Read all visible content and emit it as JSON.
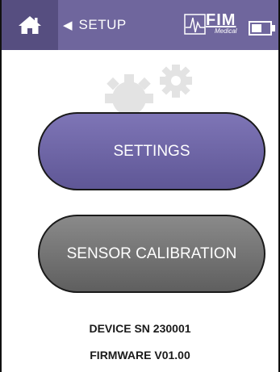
{
  "topbar": {
    "back_label": "SETUP",
    "home_icon": "home-icon",
    "back_icon": "chevron-left-icon",
    "battery_icon": "battery-icon",
    "logo": {
      "name": "FIM",
      "sub": "Medical"
    },
    "colors": {
      "bar": "#6f669d",
      "home": "#564e80"
    }
  },
  "buttons": {
    "settings_label": "SETTINGS",
    "calibration_label": "SENSOR CALIBRATION",
    "colors": {
      "settings": "#6f669d",
      "calibration": "#707070"
    }
  },
  "device": {
    "sn_text": "DEVICE SN 230001",
    "firmware_text": "FIRMWARE V01.00"
  }
}
